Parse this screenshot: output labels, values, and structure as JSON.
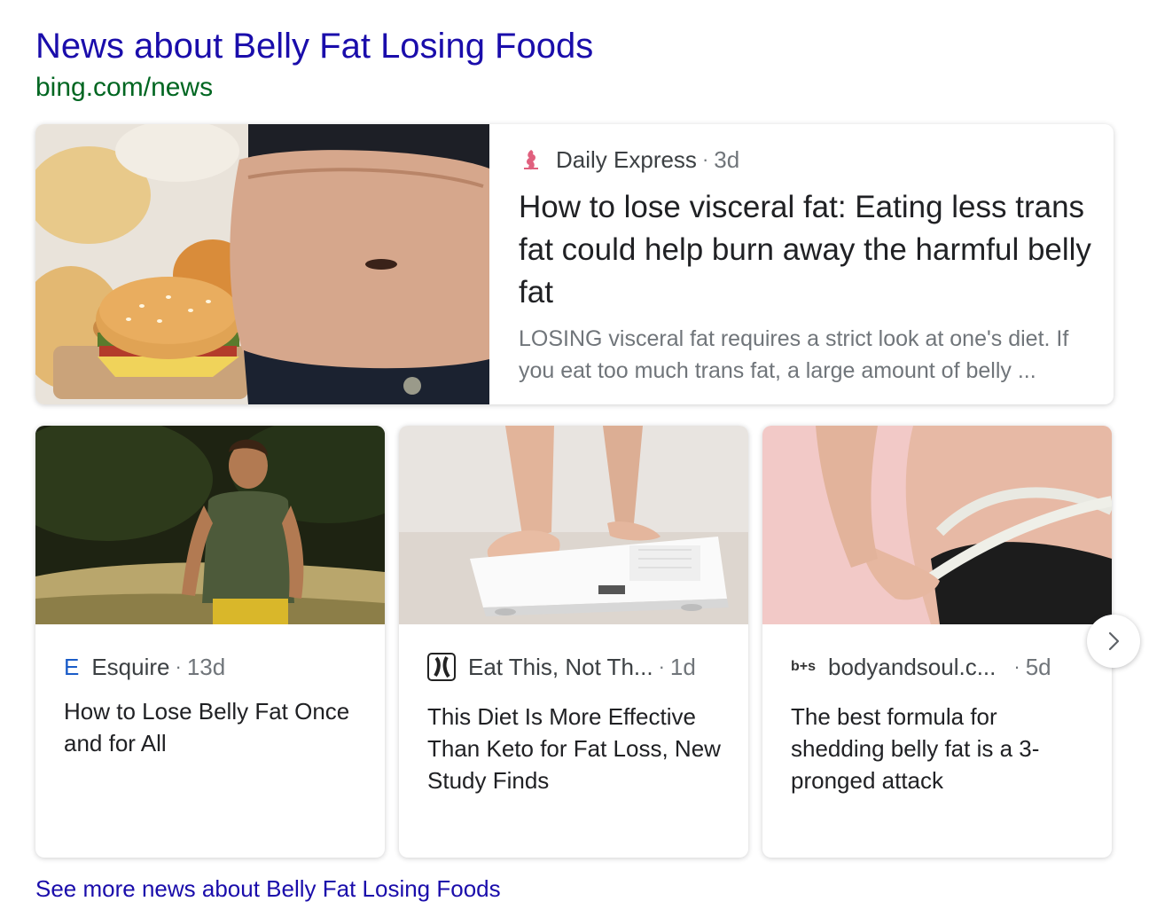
{
  "header": {
    "title": "News about Belly Fat Losing Foods",
    "url": "bing.com/news"
  },
  "featured": {
    "source": "Daily Express",
    "age": "3d",
    "separator": "·",
    "headline": "How to lose visceral fat: Eating less trans fat could help burn away the harmful belly fat",
    "snippet": "LOSING visceral fat requires a strict look at one's diet. If you eat too much trans fat, a large amount of belly ..."
  },
  "cards": [
    {
      "source_logo": "E",
      "source": "Esquire",
      "age": "13d",
      "separator": "·",
      "headline": "How to Lose Belly Fat Once and for All"
    },
    {
      "source_logo": "",
      "source": "Eat This, Not Th...",
      "age": "1d",
      "separator": "·",
      "headline": "This Diet Is More Effective Than Keto for Fat Loss, New Study Finds"
    },
    {
      "source_logo": "b+s",
      "source": "bodyandsoul.c...",
      "age": "5d",
      "separator": "·",
      "headline": "The best formula for shedding belly fat is a 3-pronged attack"
    }
  ],
  "carousel": {
    "next_icon": "chevron-right-icon"
  },
  "footer": {
    "see_more": "See more news about Belly Fat Losing Foods"
  },
  "colors": {
    "link": "#1a0dab",
    "url_green": "#006621",
    "muted": "#70757a",
    "text": "#202124"
  }
}
